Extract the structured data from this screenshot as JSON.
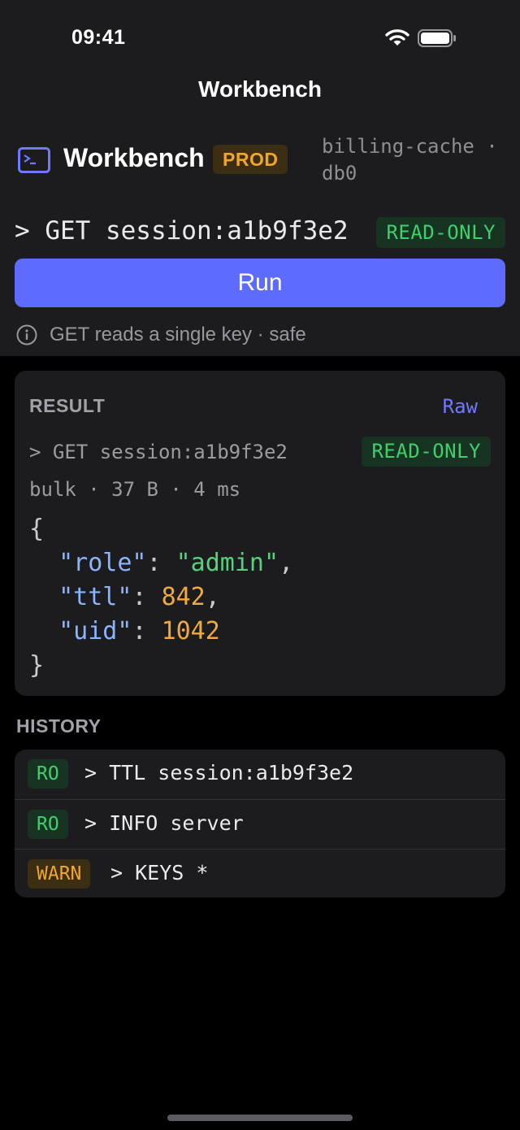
{
  "status_bar": {
    "time": "09:41",
    "wifi_icon": "wifi-icon",
    "battery_icon": "battery-icon"
  },
  "nav": {
    "title": "Workbench"
  },
  "app": {
    "icon": "terminal-icon",
    "name": "Workbench",
    "env_badge": "PROD",
    "connection": "billing-cache · db0"
  },
  "command": {
    "value": "> GET session:a1b9f3e2",
    "mode_badge": "READ-ONLY",
    "run_label": "Run",
    "hint_icon": "info-icon",
    "hint": "GET reads a single key · safe"
  },
  "result": {
    "title": "RESULT",
    "raw_label": "Raw",
    "command": "> GET session:a1b9f3e2",
    "badge": "READ-ONLY",
    "meta": "bulk · 37 B · 4 ms",
    "json": {
      "open": "{",
      "close": "}",
      "entries": [
        {
          "key": "\"role\"",
          "value": "\"admin\"",
          "kind": "string",
          "trail": ","
        },
        {
          "key": "\"ttl\"",
          "value": "842",
          "kind": "number",
          "trail": ","
        },
        {
          "key": "\"uid\"",
          "value": "1042",
          "kind": "number",
          "trail": ""
        }
      ]
    }
  },
  "history": {
    "title": "HISTORY",
    "items": [
      {
        "badge": "RO",
        "level": "ro",
        "command": "> TTL session:a1b9f3e2"
      },
      {
        "badge": "RO",
        "level": "ro",
        "command": "> INFO server"
      },
      {
        "badge": "WARN",
        "level": "warn",
        "command": "> KEYS *"
      }
    ]
  },
  "colors": {
    "accent": "#5e6bff",
    "read_only": "#3fd06d",
    "warn": "#f0a62b",
    "json_key": "#8ab4ff",
    "json_string": "#55d37a",
    "json_number": "#f2a93b"
  }
}
